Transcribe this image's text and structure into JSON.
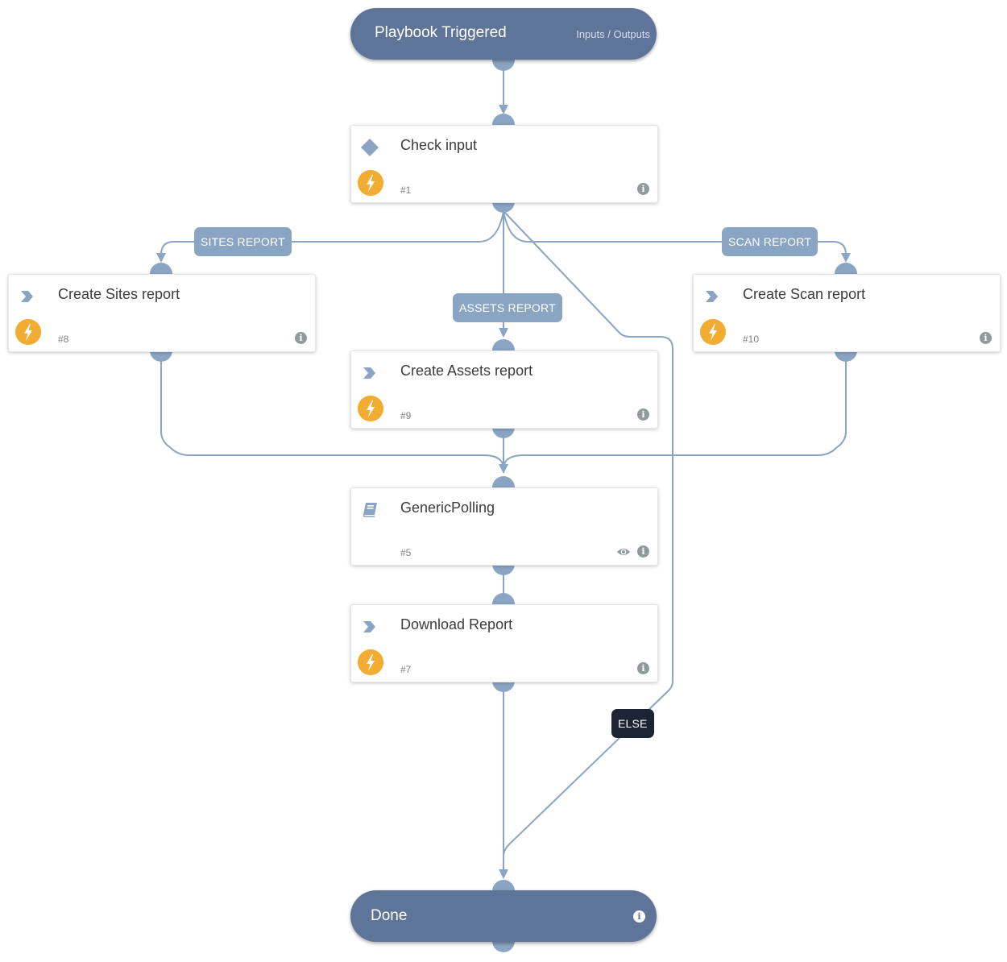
{
  "playbook": {
    "start": {
      "title": "Playbook Triggered",
      "link": "Inputs / Outputs"
    },
    "end": {
      "title": "Done",
      "info_icon": "info-icon"
    },
    "colors": {
      "terminal": "#5f7499",
      "edge": "#8aa5c3",
      "automation": "#f2ac31",
      "else_label": "#1c2333"
    },
    "tasks": [
      {
        "key": "check_input",
        "title": "Check input",
        "id": "#1",
        "type_icon": "condition-diamond-icon",
        "automation": true
      },
      {
        "key": "create_sites_report",
        "title": "Create Sites report",
        "id": "#8",
        "type_icon": "chevron-right-icon",
        "automation": true
      },
      {
        "key": "create_scan_report",
        "title": "Create Scan report",
        "id": "#10",
        "type_icon": "chevron-right-icon",
        "automation": true
      },
      {
        "key": "create_assets_report",
        "title": "Create Assets report",
        "id": "#9",
        "type_icon": "chevron-right-icon",
        "automation": true
      },
      {
        "key": "generic_polling",
        "title": "GenericPolling",
        "id": "#5",
        "type_icon": "book-icon",
        "automation": false,
        "watch": true
      },
      {
        "key": "download_report",
        "title": "Download Report",
        "id": "#7",
        "type_icon": "chevron-right-icon",
        "automation": true
      }
    ],
    "branch_labels": {
      "sites": "SITES REPORT",
      "assets": "ASSETS REPORT",
      "scan": "SCAN REPORT",
      "else": "ELSE"
    }
  }
}
